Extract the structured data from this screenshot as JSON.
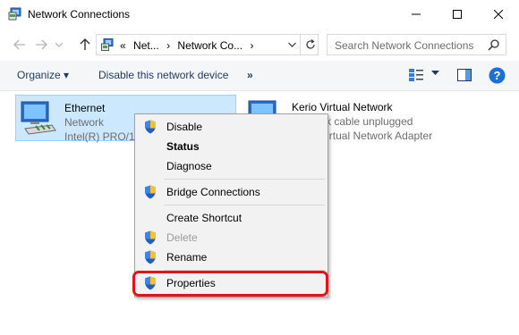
{
  "window": {
    "title": "Network Connections"
  },
  "address": {
    "crumbs": [
      "«",
      "Net...",
      "›",
      "Network Co...",
      "›"
    ],
    "search_placeholder": "Search Network Connections"
  },
  "toolbar": {
    "organize": "Organize ▾",
    "disable_device": "Disable this network device",
    "more": "»"
  },
  "adapters": [
    {
      "name": "Ethernet",
      "status": "Network",
      "device": "Intel(R) PRO/100"
    },
    {
      "name": "Kerio Virtual Network",
      "status": "Network cable unplugged",
      "device": "Kerio Virtual Network Adapter"
    }
  ],
  "context_menu": {
    "items": [
      {
        "label": "Disable",
        "shield": true,
        "bold": false,
        "enabled": true
      },
      {
        "label": "Status",
        "shield": false,
        "bold": true,
        "enabled": true
      },
      {
        "label": "Diagnose",
        "shield": false,
        "bold": false,
        "enabled": true
      },
      {
        "label": "Bridge Connections",
        "shield": true,
        "bold": false,
        "enabled": true
      },
      {
        "label": "Create Shortcut",
        "shield": false,
        "bold": false,
        "enabled": true
      },
      {
        "label": "Delete",
        "shield": true,
        "bold": false,
        "enabled": false
      },
      {
        "label": "Rename",
        "shield": true,
        "bold": false,
        "enabled": true
      },
      {
        "label": "Properties",
        "shield": true,
        "bold": false,
        "enabled": true
      }
    ]
  },
  "colors": {
    "selection_bg": "#cce8ff",
    "annotation_ring": "#e5141c",
    "help_icon": "#1e6fd9"
  }
}
